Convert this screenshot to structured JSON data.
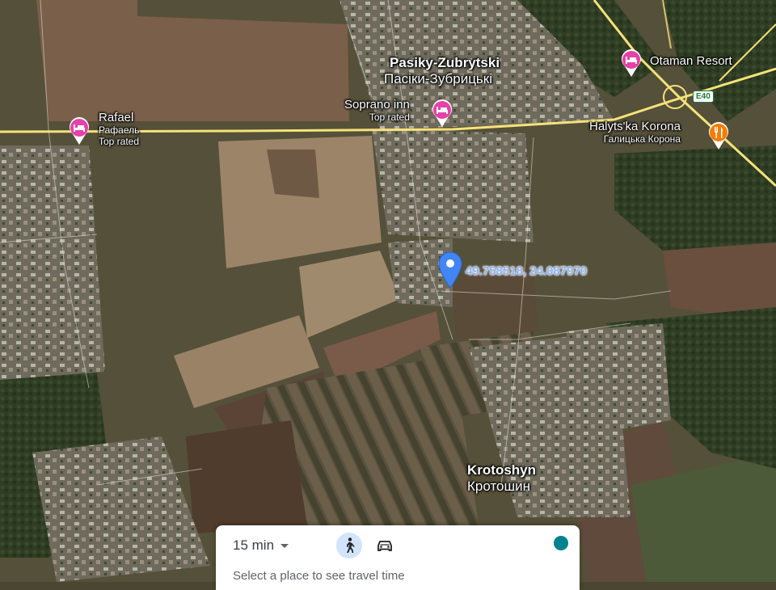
{
  "map": {
    "places": [
      {
        "name": "Pasiky-Zubrytski",
        "native": "Пасіки-Зубрицькі"
      },
      {
        "name": "Krotoshyn",
        "native": "Кротошин"
      }
    ],
    "pois": {
      "rafael": {
        "name": "Rafael",
        "native": "Рафаель",
        "note": "Top rated",
        "icon": "hotel-icon"
      },
      "soprano": {
        "name": "Soprano inn",
        "note": "Top rated",
        "icon": "hotel-icon"
      },
      "otaman": {
        "name": "Otaman Resort",
        "icon": "hotel-icon"
      },
      "korona": {
        "name": "Halyts'ka Korona",
        "native": "Галицька Корона",
        "icon": "restaurant-icon"
      }
    },
    "route_badge": "E40",
    "pin": {
      "coordinates": "49.758518, 24.087970",
      "icon": "location-pin-icon"
    },
    "colors": {
      "hotel_pin": "#e541a8",
      "restaurant_pin": "#f57c00",
      "pin_blue": "#4285f4",
      "road": "#f6e27a",
      "coord_text": "#8ab4f8",
      "toggle": "#00838f"
    }
  },
  "travel_panel": {
    "time_value": "15 min",
    "modes": [
      {
        "name": "walking",
        "icon": "walk-icon",
        "selected": true
      },
      {
        "name": "driving",
        "icon": "car-icon",
        "selected": false
      }
    ],
    "hint": "Select a place to see travel time"
  }
}
